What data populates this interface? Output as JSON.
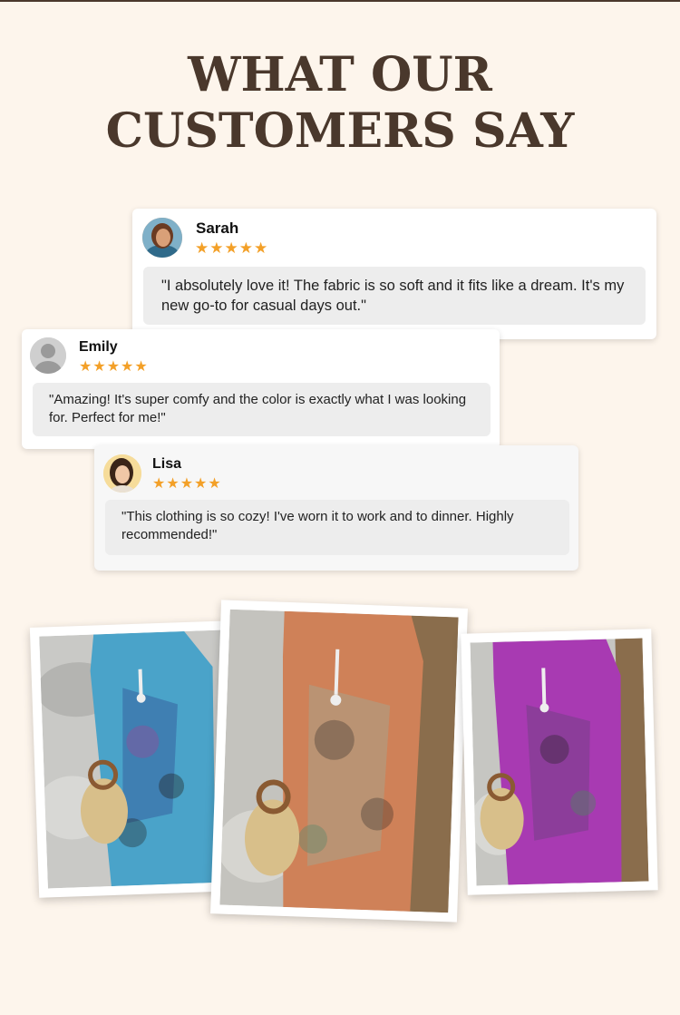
{
  "headline": {
    "line1": "WHAT OUR",
    "line2": "CUSTOMERS SAY"
  },
  "reviews": [
    {
      "name": "Sarah",
      "stars": "★★★★★",
      "rating": 5,
      "quote": "\"I absolutely love it! The fabric is so soft and it fits like a dream. It's my new go-to for casual days out.\""
    },
    {
      "name": "Emily",
      "stars": "★★★★★",
      "rating": 5,
      "quote": "\"Amazing! It's super comfy and the color is exactly what I was looking for. Perfect for me!\""
    },
    {
      "name": "Lisa",
      "stars": "★★★★★",
      "rating": 5,
      "quote": " \"This clothing is so cozy! I've worn it to work and to dinner. Highly recommended!\""
    }
  ],
  "photos": [
    {
      "icon": "blue-dress-photo",
      "color": "#4aa3c9"
    },
    {
      "icon": "orange-dress-photo",
      "color": "#cf8158"
    },
    {
      "icon": "purple-dress-photo",
      "color": "#a83ab2"
    }
  ],
  "colors": {
    "background": "#fdf5ec",
    "headline": "#4a382c",
    "star": "#f3a028",
    "quote_bg": "#ededed"
  }
}
